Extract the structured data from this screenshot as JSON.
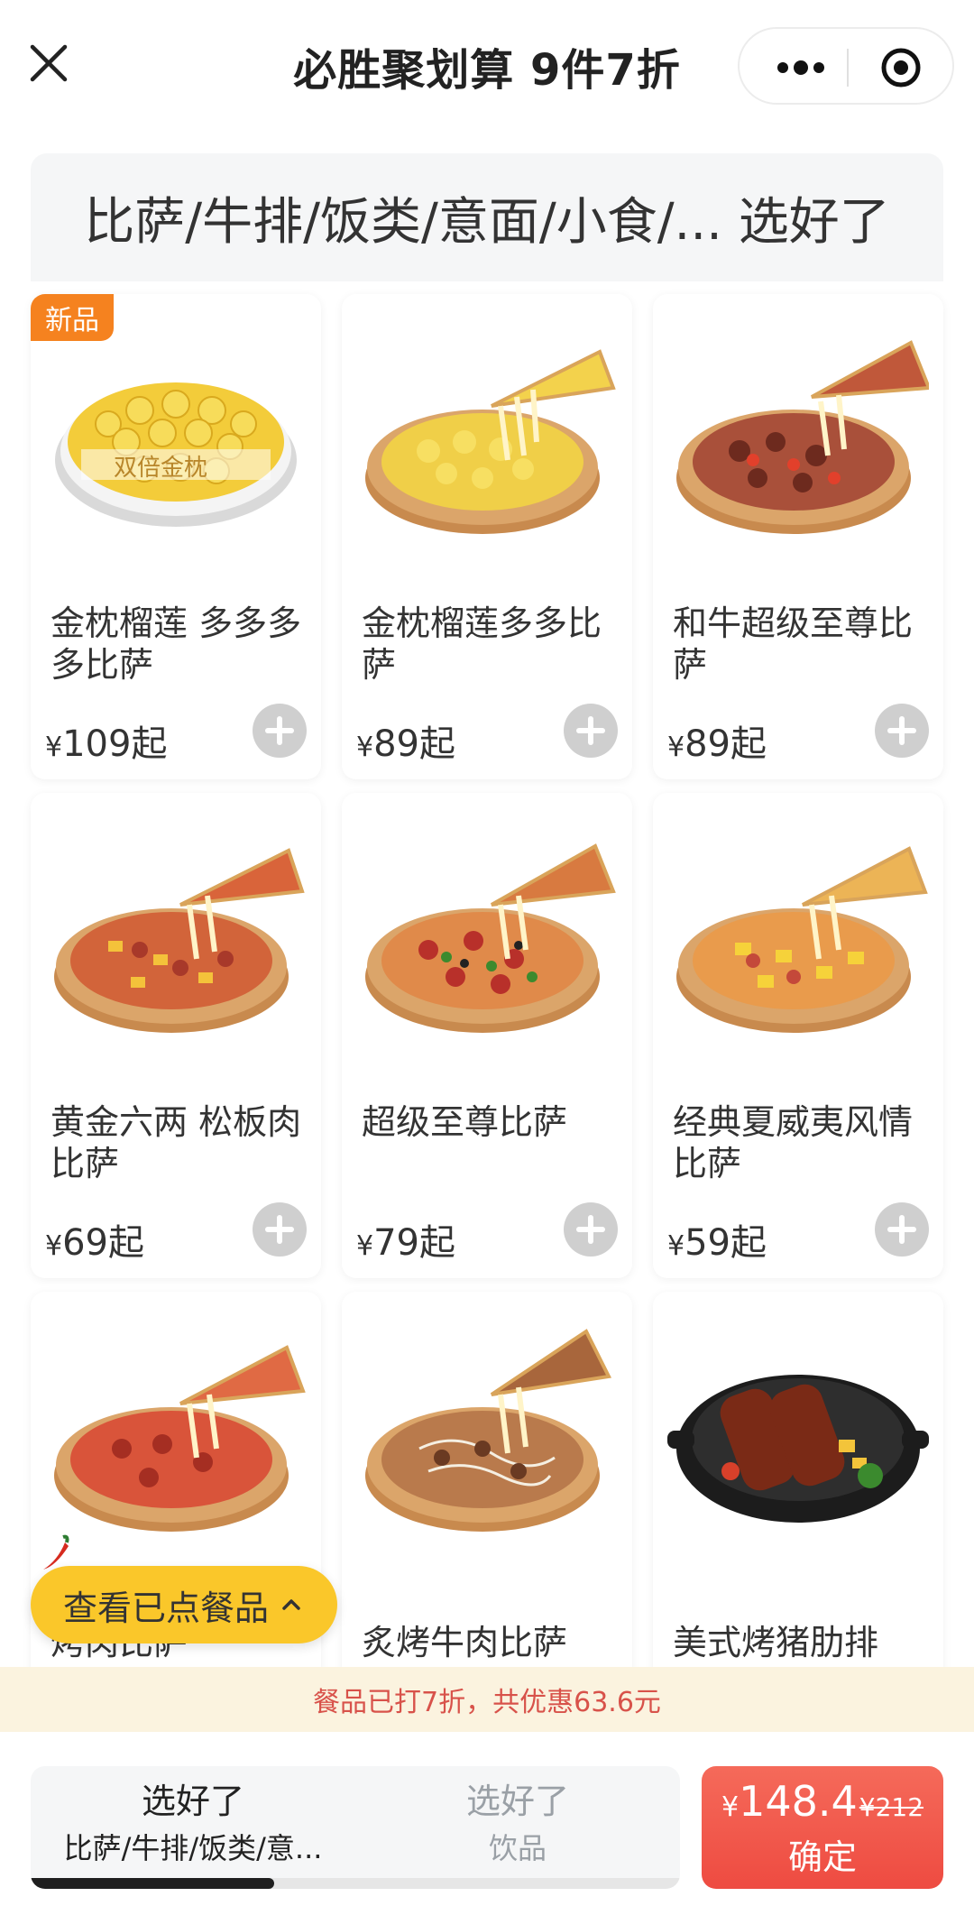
{
  "header": {
    "title": "必胜聚划算 9件7折"
  },
  "category_bar": {
    "text": "比萨/牛排/饭类/意面/小食/... 选好了"
  },
  "products": [
    {
      "name": "金枕榴莲 多多多多比萨",
      "price": "109",
      "suffix": "起",
      "badge": "新品",
      "image_caption": "双倍金枕"
    },
    {
      "name": "金枕榴莲多多比萨",
      "price": "89",
      "suffix": "起"
    },
    {
      "name": "和牛超级至尊比萨",
      "price": "89",
      "suffix": "起"
    },
    {
      "name": "黄金六两 松板肉比萨",
      "price": "69",
      "suffix": "起"
    },
    {
      "name": "超级至尊比萨",
      "price": "79",
      "suffix": "起"
    },
    {
      "name": "经典夏威夷风情比萨",
      "price": "59",
      "suffix": "起"
    },
    {
      "name": "烤肉比萨",
      "price": "",
      "suffix": ""
    },
    {
      "name": "炙烤牛肉比萨",
      "price": "",
      "suffix": ""
    },
    {
      "name": "美式烤猪肋排",
      "price": "",
      "suffix": ""
    }
  ],
  "currency": "¥",
  "floating_cart": {
    "label": "查看已点餐品"
  },
  "discount_strip": {
    "text": "餐品已打7折，共优惠63.6元"
  },
  "steps": [
    {
      "title": "选好了",
      "subtitle": "比萨/牛排/饭类/意..."
    },
    {
      "title": "选好了",
      "subtitle": "饮品"
    }
  ],
  "progress": {
    "fraction": 0.375
  },
  "confirm": {
    "currency": "¥",
    "price": "148.4",
    "original_price": "¥212",
    "label": "确定"
  },
  "colors": {
    "accent_red": "#ee4b41",
    "badge_orange": "#f5821f",
    "cart_yellow": "#fac72a",
    "discount_text": "#d8524a"
  }
}
